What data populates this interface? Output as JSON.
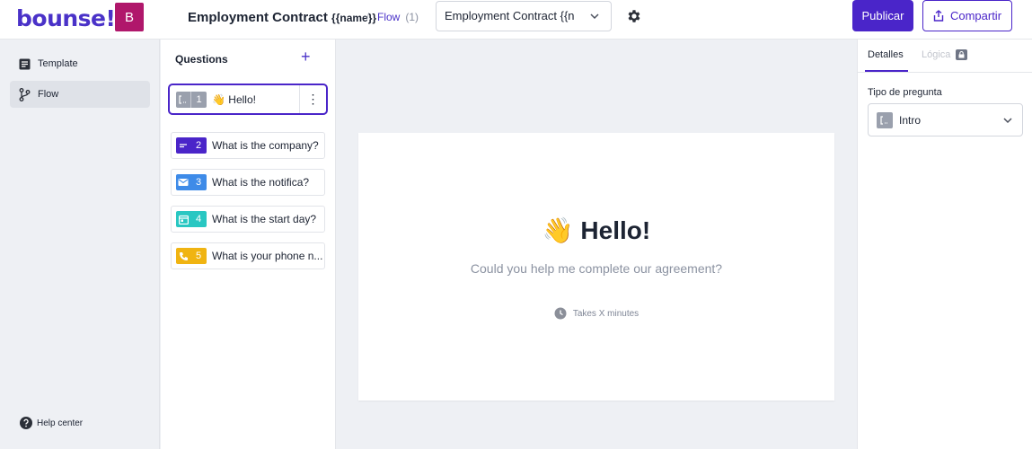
{
  "app": {
    "logo": "bounse!",
    "avatar_initial": "B"
  },
  "header": {
    "doc_title": "Employment Contract",
    "doc_title_var": "{{name}}",
    "breadcrumb_sep": "/",
    "breadcrumb_label": "Flow",
    "breadcrumb_count": "(1)",
    "template_select_value": "Employment Contract {{n",
    "publish_label": "Publicar",
    "share_label": "Compartir"
  },
  "nav": {
    "items": [
      {
        "label": "Template",
        "icon": "template-icon"
      },
      {
        "label": "Flow",
        "icon": "flow-icon"
      }
    ],
    "help_label": "Help center"
  },
  "questions": {
    "heading": "Questions",
    "add_symbol": "+",
    "menu_symbol": "⋮",
    "items": [
      {
        "number": "1",
        "text": "👋 Hello!",
        "type": "intro",
        "color": "#9aa0ad"
      },
      {
        "number": "2",
        "text": "What is the company?",
        "type": "short-text",
        "color": "#4a25c9"
      },
      {
        "number": "3",
        "text": "What is the notifica?",
        "type": "email",
        "color": "#3e8be8"
      },
      {
        "number": "4",
        "text": "What is the start day?",
        "type": "date",
        "color": "#29c7c2"
      },
      {
        "number": "5",
        "text": "What is your phone n...",
        "type": "phone",
        "color": "#f0b412"
      }
    ]
  },
  "canvas": {
    "title": "👋 Hello!",
    "subtitle": "Could you help me complete our agreement?",
    "time_note": "Takes X minutes"
  },
  "details": {
    "tab_details": "Detalles",
    "tab_logic": "Lógica",
    "question_type_label": "Tipo de pregunta",
    "question_type_value": "Intro"
  },
  "colors": {
    "accent": "#4a25c9",
    "avatar": "#b0176b"
  }
}
